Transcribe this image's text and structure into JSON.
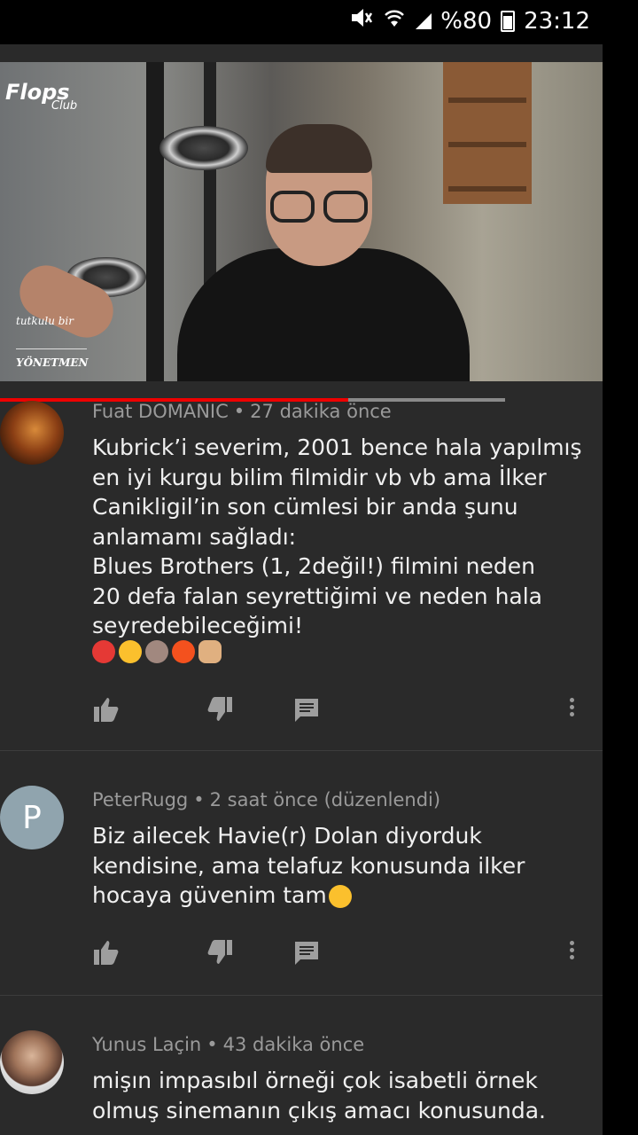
{
  "status_bar": {
    "battery_text": "%80",
    "time": "23:12",
    "icons": [
      "mute-icon",
      "wifi-icon",
      "signal-icon",
      "battery-icon"
    ]
  },
  "video": {
    "logo_main": "Flops",
    "logo_sub": "Club",
    "caption_line1": "tutkulu bir",
    "caption_line2": "YÖNETMEN",
    "progress": 0.69
  },
  "comments": [
    {
      "author": "Fuat DOMANIC",
      "time": "27 dakika önce",
      "text": "Kubrick’i severim, 2001 bence hala yapılmış\nen iyi kurgu bilim filmidir vb vb ama İlker\nCanikligil’in son cümlesi  bir anda şunu\nanlamamı sağladı:\nBlues Brothers (1, 2değil!) filmini neden\n20 defa falan seyrettiğimi ve neden hala\nseyredebileceğimi!",
      "emojis": [
        "devil-emoji",
        "laughing-emoji",
        "see-no-evil-emoji",
        "person-gesturing-emoji",
        "vulcan-salute-emoji"
      ],
      "avatar_letter": ""
    },
    {
      "author": "PeterRugg",
      "time": "2 saat önce (düzenlendi)",
      "text": "Biz ailecek Havie(r) Dolan diyorduk\nkendisine, ama telafuz konusunda ilker\nhocaya güvenim tam",
      "emojis": [
        "nerd-emoji"
      ],
      "avatar_letter": "P",
      "avatar_color": "#90a4ae"
    },
    {
      "author": "Yunus Laçin",
      "time": "43 dakika önce",
      "text": "mişın impasıbıl örneği çok isabetli örnek\nolmuş sinemanın çıkış amacı konusunda.",
      "emojis": [],
      "avatar_letter": ""
    }
  ]
}
